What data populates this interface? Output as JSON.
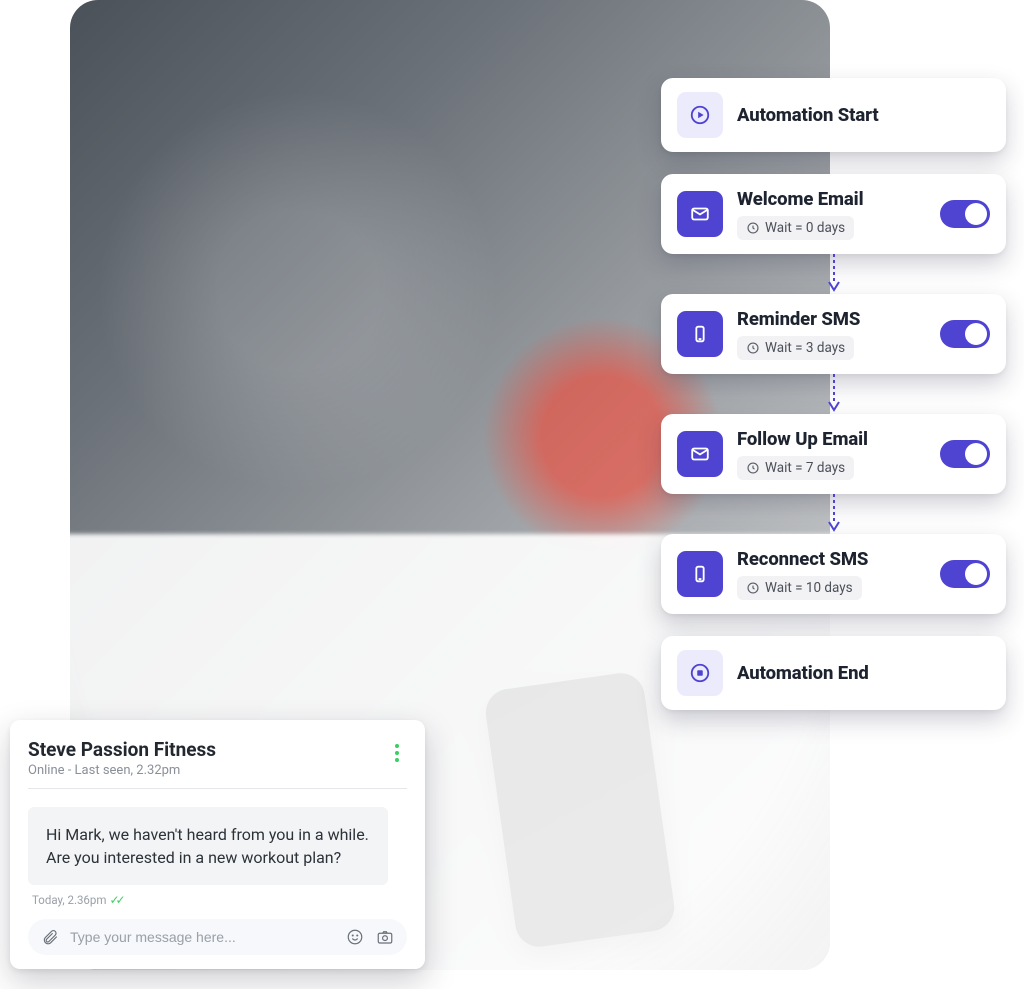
{
  "colors": {
    "accent": "#4f44d1",
    "accent_light": "#ecebfb",
    "success": "#3bcf61"
  },
  "chat": {
    "contact_name": "Steve Passion Fitness",
    "status_line": "Online - Last seen, 2.32pm",
    "message": "Hi Mark, we haven't heard from you in a while. Are you interested in a new workout plan?",
    "timestamp": "Today, 2.36pm",
    "input_placeholder": "Type your message here..."
  },
  "flow": {
    "start_label": "Automation Start",
    "end_label": "Automation End",
    "steps": [
      {
        "icon": "email",
        "title": "Welcome Email",
        "wait": "Wait = 0 days",
        "on": true
      },
      {
        "icon": "phone",
        "title": "Reminder SMS",
        "wait": "Wait = 3 days",
        "on": true
      },
      {
        "icon": "email",
        "title": "Follow Up Email",
        "wait": "Wait = 7 days",
        "on": true
      },
      {
        "icon": "phone",
        "title": "Reconnect SMS",
        "wait": "Wait = 10 days",
        "on": true
      }
    ]
  },
  "icons": {
    "play": "play-circle-icon",
    "stop": "stop-circle-icon",
    "email": "mail-icon",
    "phone": "phone-icon",
    "clock": "clock-icon",
    "attach": "paperclip-icon",
    "emoji": "smile-icon",
    "camera": "camera-icon",
    "kebab": "more-vertical-icon"
  }
}
